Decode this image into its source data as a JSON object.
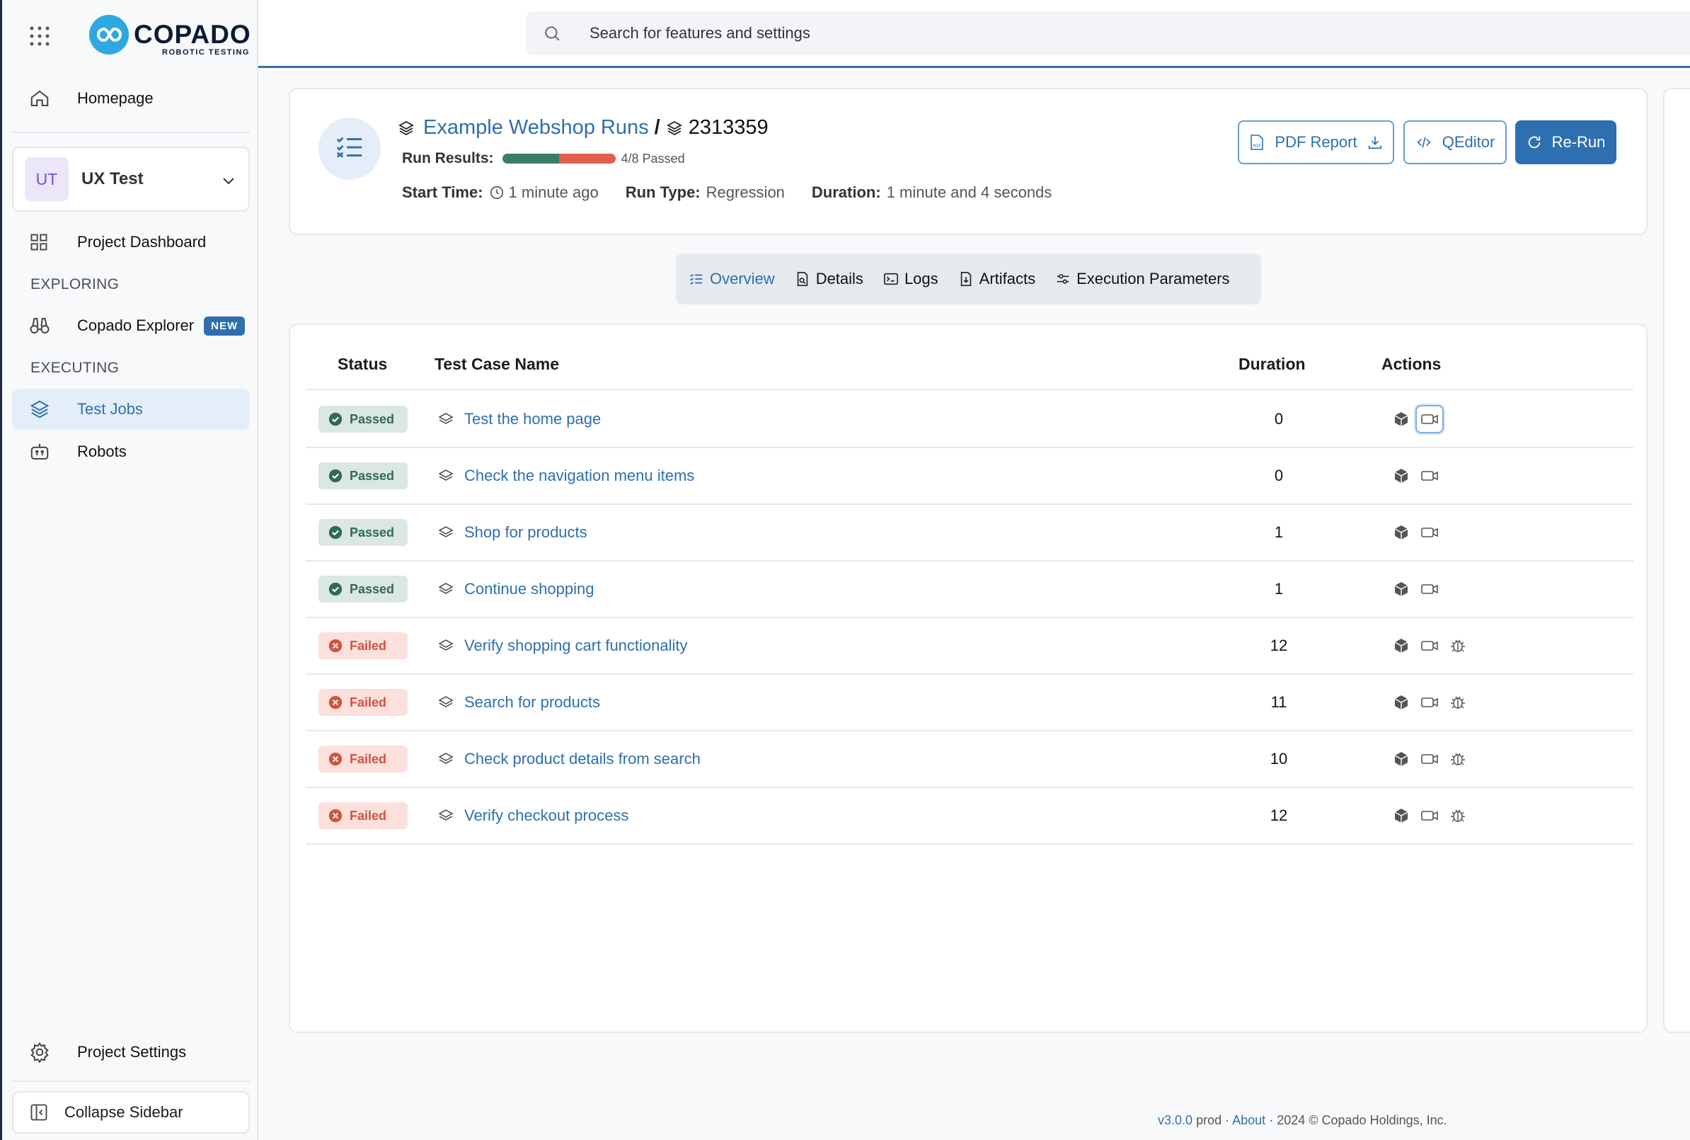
{
  "sidebar": {
    "logo_text": "COPADO",
    "logo_sub": "ROBOTIC TESTING",
    "homepage": "Homepage",
    "project": {
      "initials": "UT",
      "name": "UX Test"
    },
    "project_dashboard": "Project Dashboard",
    "section_exploring": "EXPLORING",
    "explorer": "Copado Explorer",
    "explorer_badge": "NEW",
    "section_executing": "EXECUTING",
    "test_jobs": "Test Jobs",
    "robots": "Robots",
    "project_settings": "Project Settings",
    "collapse": "Collapse Sidebar"
  },
  "search": {
    "placeholder": "Search for features and settings"
  },
  "run": {
    "crumb": "Example Webshop Runs",
    "separator": "/",
    "run_id": "2313359",
    "results_label": "Run Results:",
    "passed_fraction": 0.5,
    "passed_text": "4/8 Passed",
    "start_label": "Start Time:",
    "start_value": "1 minute ago",
    "type_label": "Run Type:",
    "type_value": "Regression",
    "duration_label": "Duration:",
    "duration_value": "1 minute and 4 seconds",
    "pdf_button": "PDF Report",
    "qeditor_button": "QEditor",
    "rerun_button": "Re-Run"
  },
  "tabs": [
    "Overview",
    "Details",
    "Logs",
    "Artifacts",
    "Execution Parameters"
  ],
  "table": {
    "headers": {
      "status": "Status",
      "name": "Test Case Name",
      "duration": "Duration",
      "actions": "Actions"
    },
    "rows": [
      {
        "status": "Passed",
        "name": "Test the home page",
        "duration": "0"
      },
      {
        "status": "Passed",
        "name": "Check the navigation menu items",
        "duration": "0"
      },
      {
        "status": "Passed",
        "name": "Shop for products",
        "duration": "1"
      },
      {
        "status": "Passed",
        "name": "Continue shopping",
        "duration": "1"
      },
      {
        "status": "Failed",
        "name": "Verify shopping cart functionality",
        "duration": "12"
      },
      {
        "status": "Failed",
        "name": "Search for products",
        "duration": "11"
      },
      {
        "status": "Failed",
        "name": "Check product details from search",
        "duration": "10"
      },
      {
        "status": "Failed",
        "name": "Verify checkout process",
        "duration": "12"
      }
    ]
  },
  "footer": {
    "version": "v3.0.0",
    "env": "prod",
    "about": "About",
    "copyright": "2024 © Copado Holdings, Inc."
  },
  "colors": {
    "accent": "#2e6fb0",
    "passed": "#3b7d6d",
    "failed": "#e0604a"
  }
}
